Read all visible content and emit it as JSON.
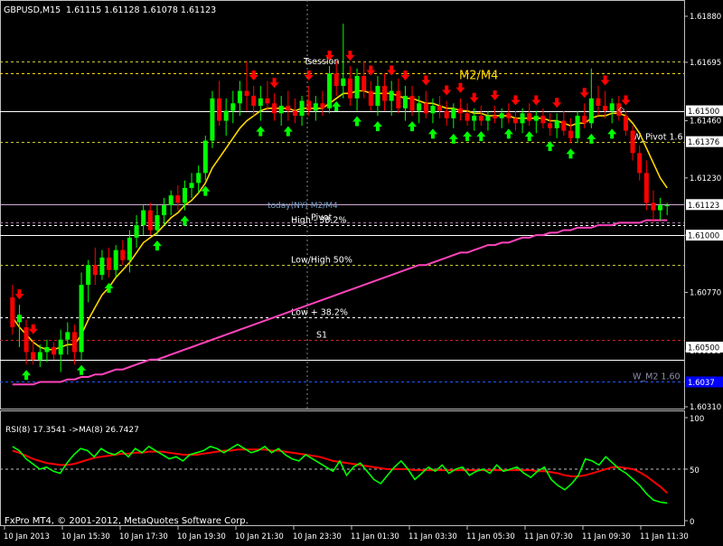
{
  "title": {
    "symbol": "GBPUSD,M15",
    "ohlc": "1.61115 1.61128 1.61078 1.61123"
  },
  "chart_data": {
    "type": "candlestick",
    "ylim": [
      1.6031,
      1.6188
    ],
    "y_ticks": [
      "1.61880",
      "1.61695",
      "1.61460",
      "1.61230",
      "1.61000",
      "1.60770",
      "1.60535",
      "1.60310"
    ],
    "price_tags": [
      {
        "value": 1.615,
        "label": "1.61500",
        "bg": "#ffffff",
        "fg": "#000000"
      },
      {
        "value": 1.61376,
        "label": "1.61376",
        "bg": "#ffffff",
        "fg": "#000000"
      },
      {
        "value": 1.61123,
        "label": "1.61123",
        "bg": "#ffffff",
        "fg": "#000000"
      },
      {
        "value": 1.61,
        "label": "1.61000",
        "bg": "#ffffff",
        "fg": "#000000"
      },
      {
        "value": 1.6055,
        "label": "1.60500",
        "bg": "#ffffff",
        "fg": "#000000"
      },
      {
        "value": 1.6041,
        "label": "1.6037",
        "bg": "#0000ff",
        "fg": "#ffffff"
      }
    ],
    "x_labels": [
      "10 Jan 2013",
      "10 Jan 15:30",
      "10 Jan 17:30",
      "10 Jan 19:30",
      "10 Jan 21:30",
      "10 Jan 23:30",
      "11 Jan 01:30",
      "11 Jan 03:30",
      "11 Jan 05:30",
      "11 Jan 07:30",
      "11 Jan 09:30",
      "11 Jan 11:30"
    ],
    "levels": [
      {
        "name": "",
        "value": 1.617,
        "color": "#c8c832",
        "dash": "3,3"
      },
      {
        "name": "M2/M4",
        "value": 1.6165,
        "color": "#ffd700",
        "dash": "3,3"
      },
      {
        "name": "",
        "value": 1.615,
        "color": "#ffffff",
        "dash": ""
      },
      {
        "name": "W_Pivot 1.6",
        "value": 1.61376,
        "color": "#c8c832",
        "dash": "3,3"
      },
      {
        "name": "",
        "value": 1.61123,
        "color": "#d2aad2",
        "dash": ""
      },
      {
        "name": "Pivot",
        "value": 1.6105,
        "color": "#aa7aaa",
        "dash": "3,3"
      },
      {
        "name": "High - 38.2%",
        "value": 1.6104,
        "color": "#ffffff",
        "dash": "3,3"
      },
      {
        "name": "",
        "value": 1.61,
        "color": "#ffffff",
        "dash": ""
      },
      {
        "name": "Low/High 50%",
        "value": 1.6088,
        "color": "#c8c832",
        "dash": "3,3"
      },
      {
        "name": "Low + 38.2%",
        "value": 1.6067,
        "color": "#ffffff",
        "dash": "3,3"
      },
      {
        "name": "S1",
        "value": 1.6058,
        "color": "#cc2222",
        "dash": "3,3"
      },
      {
        "name": "",
        "value": 1.605,
        "color": "#ffffff",
        "dash": ""
      },
      {
        "name": "W_M2 1.60",
        "value": 1.6041,
        "color": "#2255ff",
        "dash": "3,3"
      }
    ],
    "candles": [
      {
        "o": 1.6075,
        "h": 1.608,
        "l": 1.606,
        "c": 1.6063
      },
      {
        "o": 1.6065,
        "h": 1.6072,
        "l": 1.6055,
        "c": 1.6068
      },
      {
        "o": 1.6063,
        "h": 1.6066,
        "l": 1.6048,
        "c": 1.6053
      },
      {
        "o": 1.6053,
        "h": 1.6058,
        "l": 1.6048,
        "c": 1.605
      },
      {
        "o": 1.605,
        "h": 1.6056,
        "l": 1.6047,
        "c": 1.6053
      },
      {
        "o": 1.6053,
        "h": 1.6058,
        "l": 1.6049,
        "c": 1.6055
      },
      {
        "o": 1.6055,
        "h": 1.6057,
        "l": 1.605,
        "c": 1.6052
      },
      {
        "o": 1.6052,
        "h": 1.6062,
        "l": 1.6045,
        "c": 1.6058
      },
      {
        "o": 1.6058,
        "h": 1.6065,
        "l": 1.6052,
        "c": 1.6061
      },
      {
        "o": 1.6061,
        "h": 1.6064,
        "l": 1.6048,
        "c": 1.6053
      },
      {
        "o": 1.6053,
        "h": 1.6085,
        "l": 1.605,
        "c": 1.608
      },
      {
        "o": 1.608,
        "h": 1.609,
        "l": 1.6073,
        "c": 1.6088
      },
      {
        "o": 1.6088,
        "h": 1.6095,
        "l": 1.608,
        "c": 1.6084
      },
      {
        "o": 1.6084,
        "h": 1.6094,
        "l": 1.6082,
        "c": 1.6091
      },
      {
        "o": 1.6091,
        "h": 1.6095,
        "l": 1.6083,
        "c": 1.6086
      },
      {
        "o": 1.6086,
        "h": 1.6096,
        "l": 1.6083,
        "c": 1.6094
      },
      {
        "o": 1.6094,
        "h": 1.6098,
        "l": 1.6088,
        "c": 1.609
      },
      {
        "o": 1.609,
        "h": 1.6102,
        "l": 1.6085,
        "c": 1.6099
      },
      {
        "o": 1.6099,
        "h": 1.6108,
        "l": 1.6095,
        "c": 1.6104
      },
      {
        "o": 1.6104,
        "h": 1.6112,
        "l": 1.61,
        "c": 1.611
      },
      {
        "o": 1.611,
        "h": 1.6113,
        "l": 1.61,
        "c": 1.6102
      },
      {
        "o": 1.6102,
        "h": 1.6112,
        "l": 1.61,
        "c": 1.6108
      },
      {
        "o": 1.6108,
        "h": 1.6115,
        "l": 1.6104,
        "c": 1.6112
      },
      {
        "o": 1.6112,
        "h": 1.6118,
        "l": 1.6108,
        "c": 1.6116
      },
      {
        "o": 1.6116,
        "h": 1.612,
        "l": 1.611,
        "c": 1.6113
      },
      {
        "o": 1.6113,
        "h": 1.6122,
        "l": 1.611,
        "c": 1.6119
      },
      {
        "o": 1.6119,
        "h": 1.6125,
        "l": 1.6115,
        "c": 1.6121
      },
      {
        "o": 1.6121,
        "h": 1.6128,
        "l": 1.6117,
        "c": 1.6125
      },
      {
        "o": 1.6125,
        "h": 1.614,
        "l": 1.6122,
        "c": 1.6138
      },
      {
        "o": 1.6138,
        "h": 1.6158,
        "l": 1.6135,
        "c": 1.6155
      },
      {
        "o": 1.6155,
        "h": 1.6162,
        "l": 1.6144,
        "c": 1.6146
      },
      {
        "o": 1.6146,
        "h": 1.6155,
        "l": 1.614,
        "c": 1.615
      },
      {
        "o": 1.615,
        "h": 1.6158,
        "l": 1.6145,
        "c": 1.6153
      },
      {
        "o": 1.6153,
        "h": 1.6162,
        "l": 1.6148,
        "c": 1.6158
      },
      {
        "o": 1.6158,
        "h": 1.617,
        "l": 1.615,
        "c": 1.6156
      },
      {
        "o": 1.6156,
        "h": 1.616,
        "l": 1.6148,
        "c": 1.6152
      },
      {
        "o": 1.6152,
        "h": 1.616,
        "l": 1.6146,
        "c": 1.6155
      },
      {
        "o": 1.6155,
        "h": 1.6162,
        "l": 1.615,
        "c": 1.6153
      },
      {
        "o": 1.6153,
        "h": 1.6157,
        "l": 1.6146,
        "c": 1.6149
      },
      {
        "o": 1.6149,
        "h": 1.6156,
        "l": 1.6144,
        "c": 1.6152
      },
      {
        "o": 1.6152,
        "h": 1.6158,
        "l": 1.6146,
        "c": 1.615
      },
      {
        "o": 1.615,
        "h": 1.6155,
        "l": 1.6145,
        "c": 1.6148
      },
      {
        "o": 1.6148,
        "h": 1.6156,
        "l": 1.6144,
        "c": 1.6154
      },
      {
        "o": 1.6154,
        "h": 1.616,
        "l": 1.6148,
        "c": 1.615
      },
      {
        "o": 1.615,
        "h": 1.6156,
        "l": 1.6146,
        "c": 1.6153
      },
      {
        "o": 1.6153,
        "h": 1.6158,
        "l": 1.6148,
        "c": 1.6151
      },
      {
        "o": 1.6151,
        "h": 1.6168,
        "l": 1.6149,
        "c": 1.6165
      },
      {
        "o": 1.6165,
        "h": 1.617,
        "l": 1.6156,
        "c": 1.616
      },
      {
        "o": 1.616,
        "h": 1.6185,
        "l": 1.6155,
        "c": 1.6163
      },
      {
        "o": 1.6163,
        "h": 1.6168,
        "l": 1.6152,
        "c": 1.6155
      },
      {
        "o": 1.6155,
        "h": 1.6167,
        "l": 1.615,
        "c": 1.6164
      },
      {
        "o": 1.6164,
        "h": 1.617,
        "l": 1.6155,
        "c": 1.6158
      },
      {
        "o": 1.6158,
        "h": 1.6162,
        "l": 1.615,
        "c": 1.6152
      },
      {
        "o": 1.6152,
        "h": 1.6164,
        "l": 1.6148,
        "c": 1.616
      },
      {
        "o": 1.616,
        "h": 1.6165,
        "l": 1.615,
        "c": 1.6154
      },
      {
        "o": 1.6154,
        "h": 1.6162,
        "l": 1.6148,
        "c": 1.6158
      },
      {
        "o": 1.6158,
        "h": 1.6163,
        "l": 1.6149,
        "c": 1.6151
      },
      {
        "o": 1.6151,
        "h": 1.616,
        "l": 1.6146,
        "c": 1.6156
      },
      {
        "o": 1.6156,
        "h": 1.616,
        "l": 1.6148,
        "c": 1.615
      },
      {
        "o": 1.615,
        "h": 1.6156,
        "l": 1.6145,
        "c": 1.6153
      },
      {
        "o": 1.6153,
        "h": 1.6158,
        "l": 1.6147,
        "c": 1.6149
      },
      {
        "o": 1.6149,
        "h": 1.6155,
        "l": 1.6145,
        "c": 1.6152
      },
      {
        "o": 1.6152,
        "h": 1.6156,
        "l": 1.6147,
        "c": 1.615
      },
      {
        "o": 1.615,
        "h": 1.6154,
        "l": 1.6144,
        "c": 1.6147
      },
      {
        "o": 1.6147,
        "h": 1.6153,
        "l": 1.6143,
        "c": 1.6151
      },
      {
        "o": 1.6151,
        "h": 1.6155,
        "l": 1.6146,
        "c": 1.6149
      },
      {
        "o": 1.6149,
        "h": 1.6153,
        "l": 1.6144,
        "c": 1.6146
      },
      {
        "o": 1.6146,
        "h": 1.6151,
        "l": 1.6142,
        "c": 1.6148
      },
      {
        "o": 1.6148,
        "h": 1.6152,
        "l": 1.6144,
        "c": 1.6146
      },
      {
        "o": 1.6146,
        "h": 1.615,
        "l": 1.6142,
        "c": 1.6148
      },
      {
        "o": 1.6148,
        "h": 1.6152,
        "l": 1.6145,
        "c": 1.6147
      },
      {
        "o": 1.6147,
        "h": 1.6151,
        "l": 1.6143,
        "c": 1.6149
      },
      {
        "o": 1.6149,
        "h": 1.6153,
        "l": 1.6145,
        "c": 1.6147
      },
      {
        "o": 1.6147,
        "h": 1.615,
        "l": 1.6142,
        "c": 1.6145
      },
      {
        "o": 1.6145,
        "h": 1.6151,
        "l": 1.6141,
        "c": 1.6149
      },
      {
        "o": 1.6149,
        "h": 1.6153,
        "l": 1.6144,
        "c": 1.6146
      },
      {
        "o": 1.6146,
        "h": 1.615,
        "l": 1.6141,
        "c": 1.6148
      },
      {
        "o": 1.6148,
        "h": 1.6151,
        "l": 1.6143,
        "c": 1.6145
      },
      {
        "o": 1.6145,
        "h": 1.6149,
        "l": 1.614,
        "c": 1.6143
      },
      {
        "o": 1.6143,
        "h": 1.6149,
        "l": 1.6139,
        "c": 1.6146
      },
      {
        "o": 1.6146,
        "h": 1.615,
        "l": 1.614,
        "c": 1.6142
      },
      {
        "o": 1.6142,
        "h": 1.6147,
        "l": 1.6137,
        "c": 1.6139
      },
      {
        "o": 1.6139,
        "h": 1.615,
        "l": 1.6137,
        "c": 1.6148
      },
      {
        "o": 1.6148,
        "h": 1.6153,
        "l": 1.6143,
        "c": 1.6145
      },
      {
        "o": 1.6145,
        "h": 1.6167,
        "l": 1.6143,
        "c": 1.6155
      },
      {
        "o": 1.6155,
        "h": 1.616,
        "l": 1.6148,
        "c": 1.6152
      },
      {
        "o": 1.6152,
        "h": 1.6158,
        "l": 1.6147,
        "c": 1.615
      },
      {
        "o": 1.615,
        "h": 1.6155,
        "l": 1.6145,
        "c": 1.6153
      },
      {
        "o": 1.6153,
        "h": 1.6156,
        "l": 1.6146,
        "c": 1.6148
      },
      {
        "o": 1.6148,
        "h": 1.615,
        "l": 1.614,
        "c": 1.6142
      },
      {
        "o": 1.6142,
        "h": 1.6144,
        "l": 1.613,
        "c": 1.6133
      },
      {
        "o": 1.6133,
        "h": 1.6136,
        "l": 1.6122,
        "c": 1.6125
      },
      {
        "o": 1.6125,
        "h": 1.613,
        "l": 1.611,
        "c": 1.6113
      },
      {
        "o": 1.6113,
        "h": 1.6118,
        "l": 1.6105,
        "c": 1.611
      },
      {
        "o": 1.611,
        "h": 1.6115,
        "l": 1.6106,
        "c": 1.6112
      },
      {
        "o": 1.6112,
        "h": 1.6113,
        "l": 1.6108,
        "c": 1.6112
      }
    ],
    "series": [
      {
        "name": "",
        "color": "#ffd700",
        "values": [
          1.6067,
          1.6063,
          1.606,
          1.6057,
          1.6055,
          1.6054,
          1.6054,
          1.6055,
          1.6056,
          1.6056,
          1.606,
          1.6066,
          1.6071,
          1.6076,
          1.6079,
          1.6083,
          1.6086,
          1.6089,
          1.6093,
          1.6097,
          1.6099,
          1.6101,
          1.6104,
          1.6107,
          1.6109,
          1.6112,
          1.6114,
          1.6117,
          1.6121,
          1.6127,
          1.6131,
          1.6135,
          1.6139,
          1.6143,
          1.6146,
          1.6148,
          1.615,
          1.6151,
          1.6151,
          1.6151,
          1.6151,
          1.615,
          1.6151,
          1.6151,
          1.6151,
          1.6151,
          1.6153,
          1.6155,
          1.6157,
          1.6157,
          1.6158,
          1.6158,
          1.6157,
          1.6157,
          1.6157,
          1.6157,
          1.6156,
          1.6155,
          1.6155,
          1.6154,
          1.6153,
          1.6153,
          1.6152,
          1.6151,
          1.6151,
          1.615,
          1.615,
          1.6149,
          1.6149,
          1.6148,
          1.6148,
          1.6148,
          1.6148,
          1.6147,
          1.6147,
          1.6147,
          1.6147,
          1.6147,
          1.6146,
          1.6146,
          1.6145,
          1.6144,
          1.6145,
          1.6145,
          1.6147,
          1.6148,
          1.6148,
          1.6149,
          1.6149,
          1.6148,
          1.6145,
          1.6141,
          1.6135,
          1.6129,
          1.6123,
          1.6119
        ]
      },
      {
        "name": "",
        "color": "#ff44bb",
        "values": [
          1.604,
          1.604,
          1.604,
          1.604,
          1.6041,
          1.6041,
          1.6041,
          1.6041,
          1.6042,
          1.6042,
          1.6043,
          1.6043,
          1.6044,
          1.6044,
          1.6045,
          1.6046,
          1.6046,
          1.6047,
          1.6048,
          1.6049,
          1.605,
          1.605,
          1.6051,
          1.6052,
          1.6053,
          1.6054,
          1.6055,
          1.6056,
          1.6057,
          1.6058,
          1.6059,
          1.606,
          1.6061,
          1.6062,
          1.6063,
          1.6064,
          1.6065,
          1.6066,
          1.6067,
          1.6068,
          1.6069,
          1.607,
          1.6071,
          1.6072,
          1.6073,
          1.6074,
          1.6075,
          1.6076,
          1.6077,
          1.6078,
          1.6079,
          1.608,
          1.6081,
          1.6082,
          1.6083,
          1.6084,
          1.6085,
          1.6086,
          1.6087,
          1.6088,
          1.6088,
          1.6089,
          1.609,
          1.6091,
          1.6092,
          1.6093,
          1.6093,
          1.6094,
          1.6095,
          1.6096,
          1.6096,
          1.6097,
          1.6097,
          1.6098,
          1.6099,
          1.6099,
          1.61,
          1.61,
          1.6101,
          1.6101,
          1.6102,
          1.6102,
          1.6103,
          1.6103,
          1.6103,
          1.6104,
          1.6104,
          1.6104,
          1.6105,
          1.6105,
          1.6105,
          1.6105,
          1.6106,
          1.6106,
          1.6106,
          1.6106
        ]
      }
    ],
    "signals_up": [
      2,
      10,
      14,
      21,
      25,
      28,
      36,
      40,
      47,
      50,
      53,
      58,
      61,
      64,
      66,
      68,
      72,
      75,
      78,
      81,
      84,
      87
    ],
    "signals_down": [
      1,
      3,
      35,
      38,
      43,
      46,
      49,
      52,
      55,
      57,
      60,
      63,
      65,
      67,
      70,
      73,
      76,
      79,
      83,
      86,
      89
    ],
    "labels": {
      "today": "today(NY) M2/M4",
      "tsession": "Tsession",
      "diamond_marker": "◇"
    }
  },
  "rsi_panel": {
    "label": "RSI(8) 17.3541  ->MA(8) 26.7427",
    "ylim": [
      0,
      100
    ],
    "y_ticks": [
      "100",
      "50",
      "0"
    ],
    "level": 50,
    "rsi_values": [
      72,
      68,
      60,
      55,
      50,
      52,
      48,
      46,
      56,
      64,
      70,
      68,
      62,
      70,
      66,
      64,
      68,
      62,
      70,
      66,
      72,
      68,
      64,
      60,
      62,
      58,
      64,
      66,
      68,
      72,
      70,
      66,
      70,
      74,
      70,
      66,
      68,
      72,
      66,
      70,
      64,
      60,
      58,
      64,
      60,
      56,
      52,
      48,
      58,
      44,
      52,
      56,
      48,
      40,
      36,
      44,
      52,
      58,
      50,
      40,
      46,
      52,
      48,
      54,
      46,
      50,
      52,
      44,
      48,
      50,
      46,
      54,
      48,
      50,
      52,
      46,
      42,
      48,
      52,
      40,
      34,
      30,
      36,
      44,
      60,
      58,
      54,
      62,
      56,
      50,
      46,
      40,
      34,
      26,
      20,
      18,
      17
    ],
    "ma_values": [
      68,
      66,
      63,
      60,
      58,
      56,
      55,
      54,
      54,
      55,
      57,
      59,
      61,
      62,
      63,
      64,
      65,
      65,
      66,
      66,
      67,
      67,
      67,
      66,
      65,
      64,
      64,
      64,
      65,
      66,
      67,
      68,
      68,
      69,
      69,
      69,
      69,
      69,
      68,
      68,
      67,
      66,
      65,
      64,
      63,
      62,
      60,
      58,
      57,
      56,
      55,
      54,
      53,
      52,
      51,
      50,
      50,
      50,
      50,
      49,
      49,
      49,
      49,
      49,
      49,
      49,
      49,
      49,
      49,
      49,
      49,
      49,
      49,
      49,
      49,
      49,
      49,
      48,
      48,
      47,
      46,
      44,
      43,
      43,
      44,
      46,
      48,
      50,
      52,
      52,
      51,
      50,
      47,
      43,
      38,
      33,
      27
    ]
  },
  "footer": {
    "copyright": "FxPro MT4, © 2001-2012, MetaQuotes Software Corp."
  }
}
